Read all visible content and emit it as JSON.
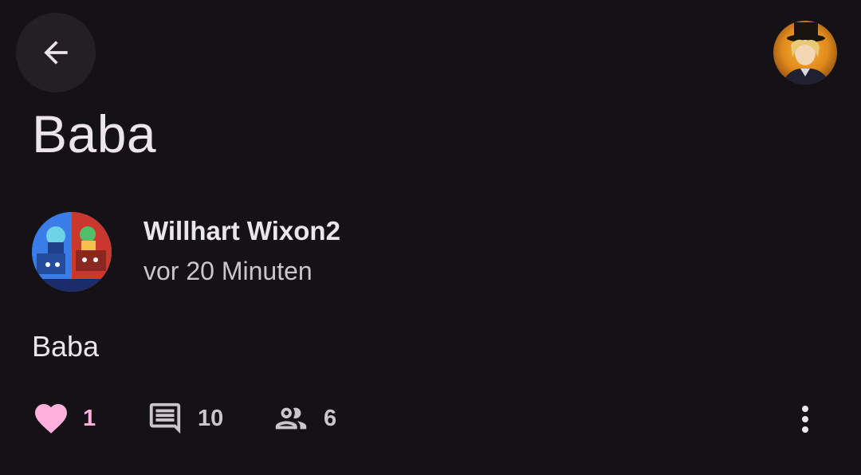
{
  "header": {
    "back_icon": "arrow-back-icon",
    "account_avatar": "account-avatar-image"
  },
  "post": {
    "title": "Baba",
    "author": {
      "name": "Willhart Wixon2",
      "time": "vor 20 Minuten",
      "avatar": "author-avatar-image"
    },
    "body": "Baba",
    "actions": {
      "likes": "1",
      "comments": "10",
      "participants": "6",
      "like_icon": "heart-icon",
      "comment_icon": "comment-icon",
      "participants_icon": "people-icon",
      "more_icon": "more-vert-icon"
    }
  },
  "colors": {
    "background": "#151215",
    "surface": "#241f24",
    "text": "#ece6ec",
    "muted_text": "#cdc5cd",
    "accent_pink": "#ffb0dd"
  }
}
